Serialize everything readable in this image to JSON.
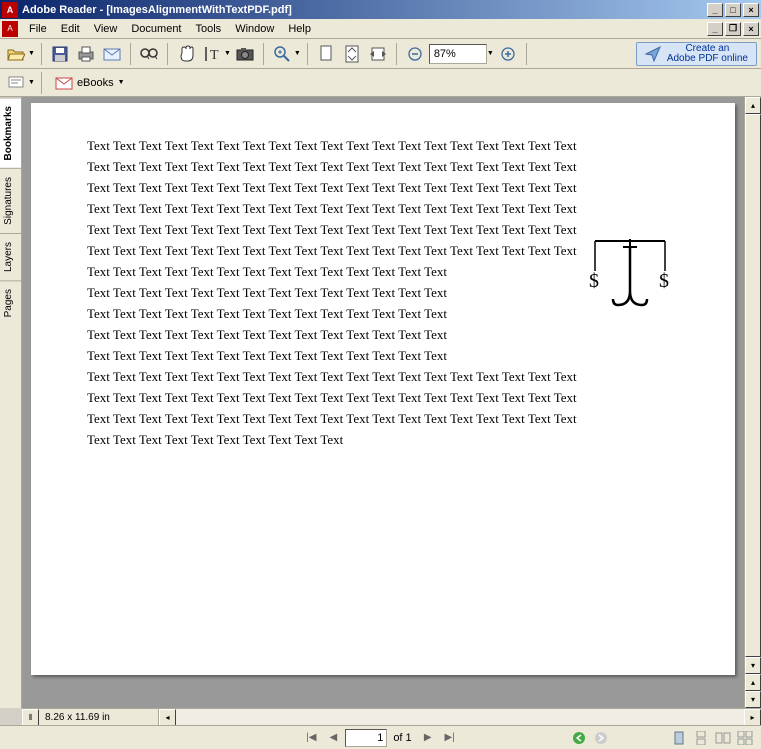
{
  "window": {
    "title": "Adobe Reader - [ImagesAlignmentWithTextPDF.pdf]"
  },
  "menu": {
    "items": [
      "File",
      "Edit",
      "View",
      "Document",
      "Tools",
      "Window",
      "Help"
    ]
  },
  "toolbar": {
    "zoom_value": "87%",
    "create_online_line1": "Create an",
    "create_online_line2": "Adobe PDF online",
    "ebooks": "eBooks"
  },
  "sidebar": {
    "tabs": [
      "Bookmarks",
      "Signatures",
      "Layers",
      "Pages"
    ]
  },
  "document": {
    "lines": [
      "Text Text Text Text Text Text Text Text Text Text Text Text Text Text Text Text Text Text Text",
      "Text Text Text Text Text Text Text Text Text Text Text Text Text Text Text Text Text Text Text",
      "Text Text Text Text Text Text Text Text Text Text Text Text Text Text Text Text Text Text Text",
      "Text Text Text Text Text Text Text Text Text Text Text Text Text Text Text Text Text Text Text",
      "Text Text Text Text Text Text Text Text Text Text Text Text Text Text Text Text Text Text Text",
      "Text Text Text Text Text Text Text Text Text Text Text Text Text Text Text Text Text Text Text",
      "Text Text Text Text Text Text Text Text Text Text Text Text Text Text",
      "Text Text Text Text Text Text Text Text Text Text Text Text Text Text",
      "Text Text Text Text Text Text Text Text Text Text Text Text Text Text",
      "Text Text Text Text Text Text Text Text Text Text Text Text Text Text",
      "Text Text Text Text Text Text Text Text Text Text Text Text Text Text",
      "Text Text Text Text Text Text Text Text Text Text Text Text Text Text Text Text Text Text Text",
      "Text Text Text Text Text Text Text Text Text Text Text Text Text Text Text Text Text Text Text",
      "Text Text Text Text Text Text Text Text Text Text Text Text Text Text Text Text Text Text Text",
      "Text Text Text Text Text Text Text Text Text Text"
    ],
    "dimensions": "8.26 x 11.69 in"
  },
  "status": {
    "page_current": "1",
    "page_of": "of 1"
  }
}
